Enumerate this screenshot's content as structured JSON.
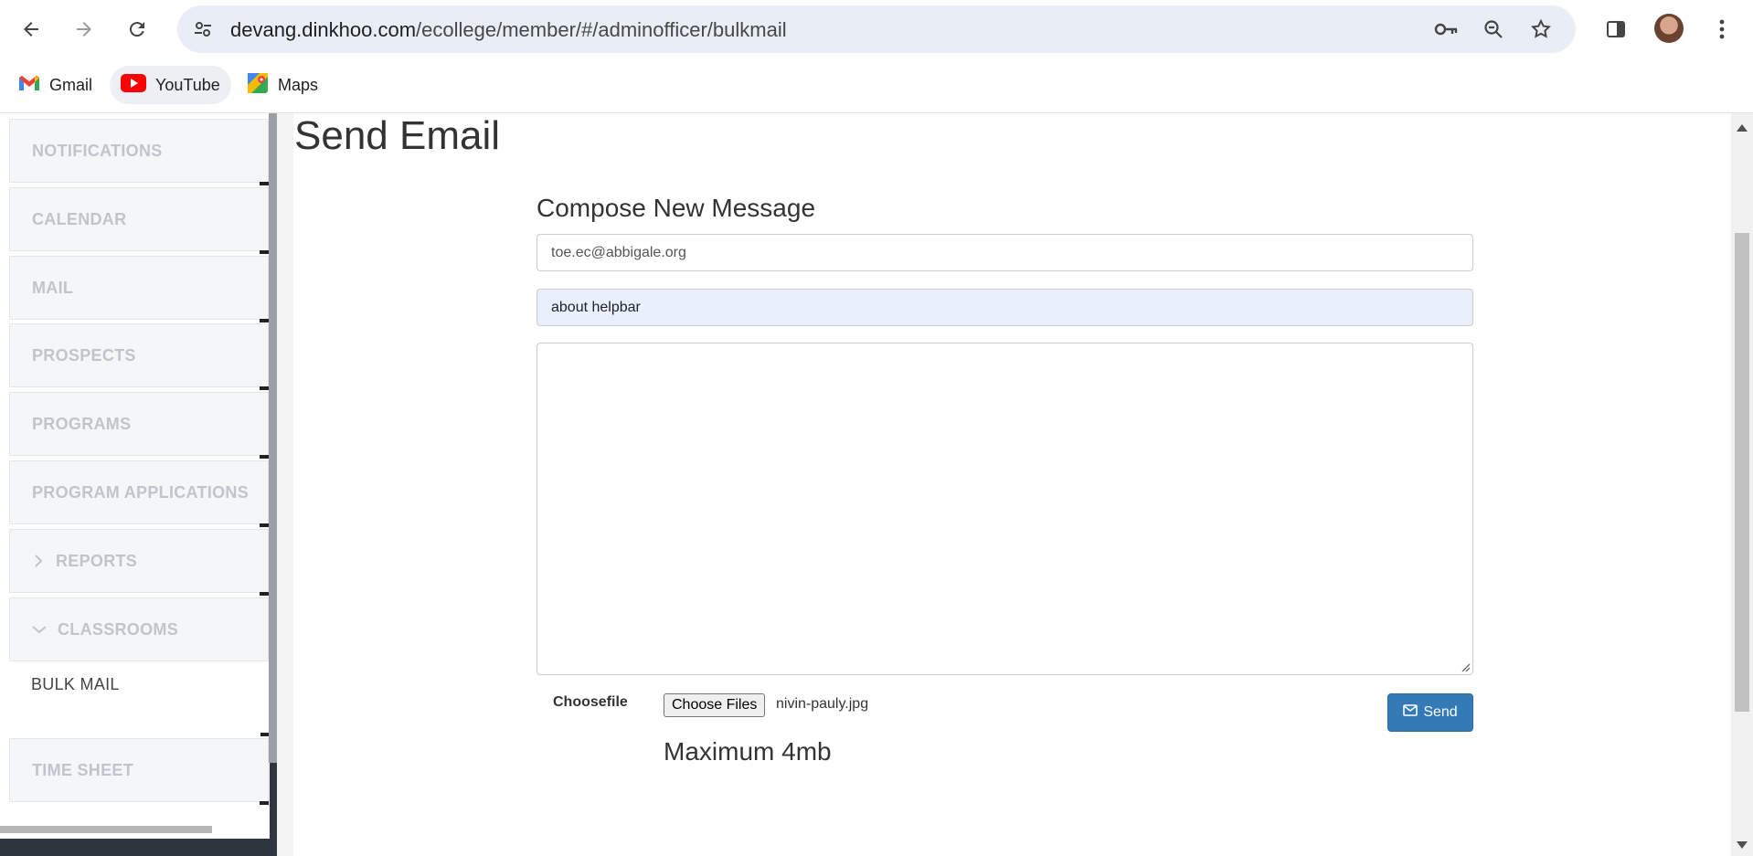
{
  "browser": {
    "url_host": "devang.dinkhoo.com",
    "url_path": "/ecollege/member/#/adminofficer/bulkmail",
    "bookmarks": [
      {
        "label": "Gmail",
        "icon": "gmail-icon"
      },
      {
        "label": "YouTube",
        "icon": "youtube-icon"
      },
      {
        "label": "Maps",
        "icon": "maps-icon"
      }
    ]
  },
  "sidebar": {
    "items": [
      {
        "label": "NOTIFICATIONS"
      },
      {
        "label": "CALENDAR"
      },
      {
        "label": "MAIL"
      },
      {
        "label": "PROSPECTS"
      },
      {
        "label": "PROGRAMS"
      },
      {
        "label": "PROGRAM APPLICATIONS"
      },
      {
        "label": "REPORTS",
        "icon": "chevron-right-icon"
      },
      {
        "label": "CLASSROOMS",
        "icon": "chevron-down-icon"
      },
      {
        "label": "BULK MAIL",
        "active": true
      },
      {
        "label": "TIME SHEET"
      }
    ]
  },
  "main": {
    "page_title": "Send Email",
    "compose_title": "Compose New Message",
    "to_value": "toe.ec@abbigale.org",
    "subject_value": "about helpbar",
    "body_value": "",
    "choosefile_label": "Choosefile",
    "choose_files_button": "Choose Files",
    "file_name": "nivin-pauly.jpg",
    "send_label": "Send",
    "max_note": "Maximum 4mb"
  },
  "colors": {
    "send_button": "#337ab7",
    "autofill_bg": "#e8f0fe",
    "sidebar_dark": "#2f3640"
  }
}
